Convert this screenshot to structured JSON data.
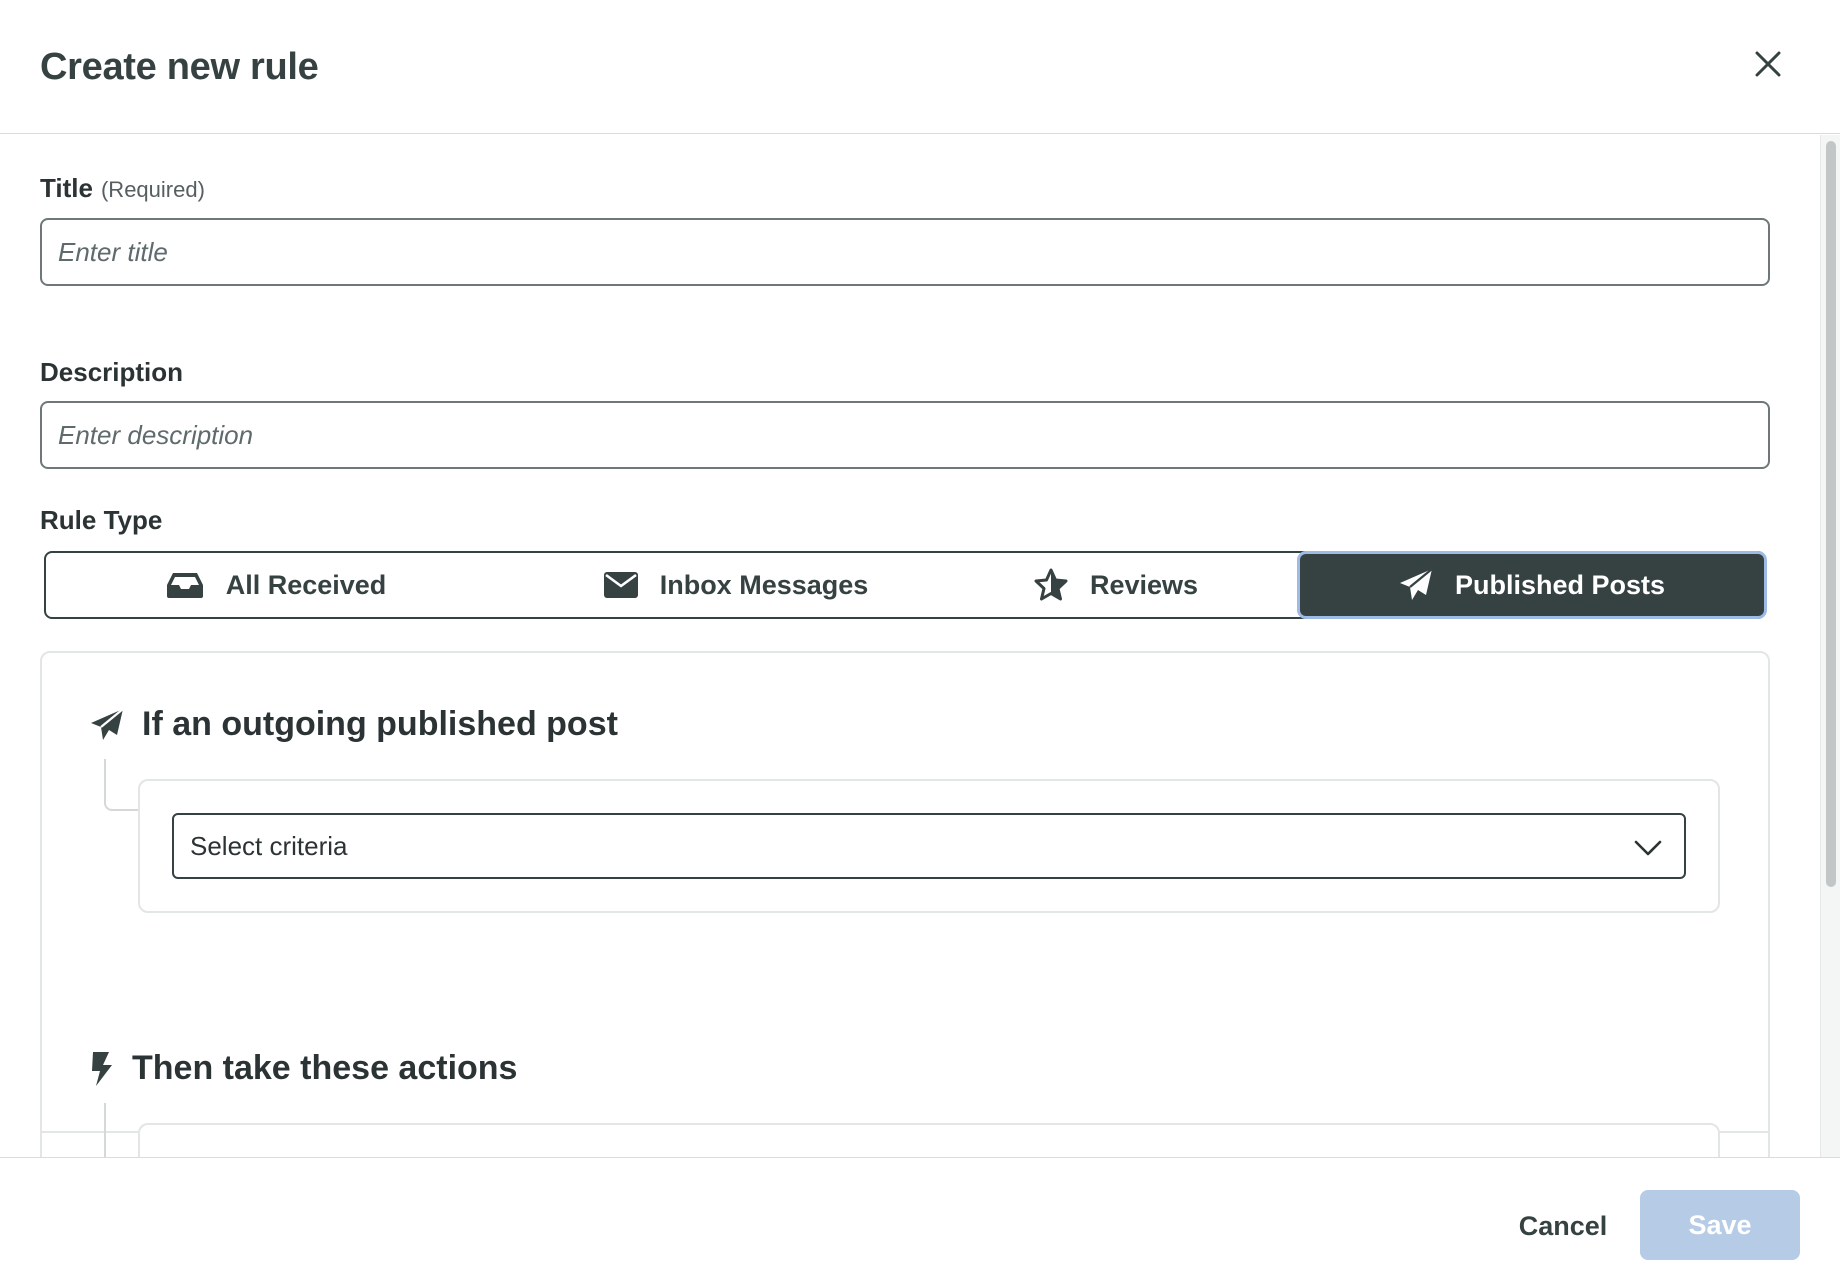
{
  "header": {
    "title": "Create new rule"
  },
  "form": {
    "title_label": "Title",
    "title_required": "(Required)",
    "title_placeholder": "Enter title",
    "description_label": "Description",
    "description_placeholder": "Enter description",
    "rule_type_label": "Rule Type"
  },
  "rule_types": [
    {
      "label": "All Received",
      "icon": "inbox-icon",
      "selected": false
    },
    {
      "label": "Inbox Messages",
      "icon": "envelope-icon",
      "selected": false
    },
    {
      "label": "Reviews",
      "icon": "star-icon",
      "selected": false
    },
    {
      "label": "Published Posts",
      "icon": "paper-plane-icon",
      "selected": true
    }
  ],
  "conditions": {
    "title": "If an outgoing published post",
    "icon": "paper-plane-icon",
    "select_value": "Select criteria"
  },
  "actions": {
    "title": "Then take these actions",
    "icon": "bolt-icon"
  },
  "footer": {
    "cancel_label": "Cancel",
    "save_label": "Save"
  },
  "colors": {
    "primary_dark": "#364141",
    "save_disabled": "#b6cbe6",
    "focus_ring": "#9ebbe6"
  }
}
